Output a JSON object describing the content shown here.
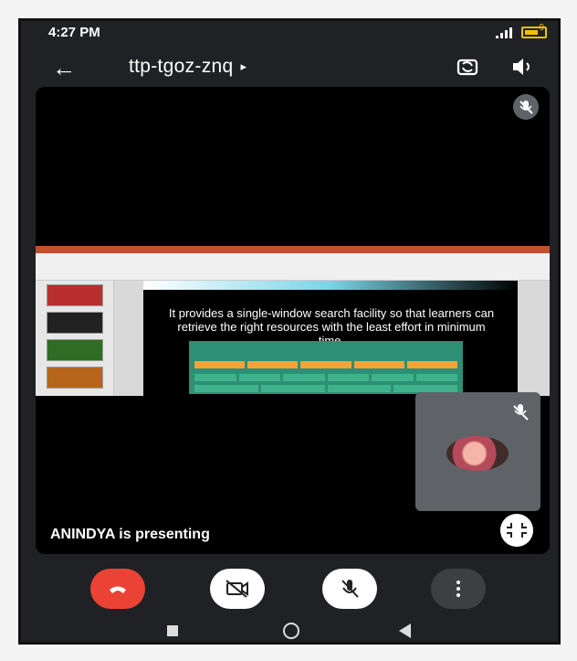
{
  "status_bar": {
    "time": "4:27 PM",
    "battery_level": "9"
  },
  "header": {
    "back_icon": "back-arrow-icon",
    "meeting_code": "ttp-tgoz-znq",
    "caret": "▸",
    "switch_camera_icon": "switch-camera-icon",
    "speaker_icon": "speaker-icon"
  },
  "stage": {
    "presenter_text": "ANINDYA is presenting",
    "slide_text": "It provides a single-window search facility so that learners can retrieve the right resources with the least effort in minimum time."
  },
  "controls": {
    "end_call_icon": "end-call-icon",
    "camera_icon": "camera-off-icon",
    "microphone_icon": "microphone-off-icon",
    "more_icon": "more-options-icon",
    "accent_color": "#ea4335"
  },
  "system_nav": {
    "recents_icon": "recents-icon",
    "home_icon": "home-icon",
    "back_icon": "system-back-icon"
  }
}
